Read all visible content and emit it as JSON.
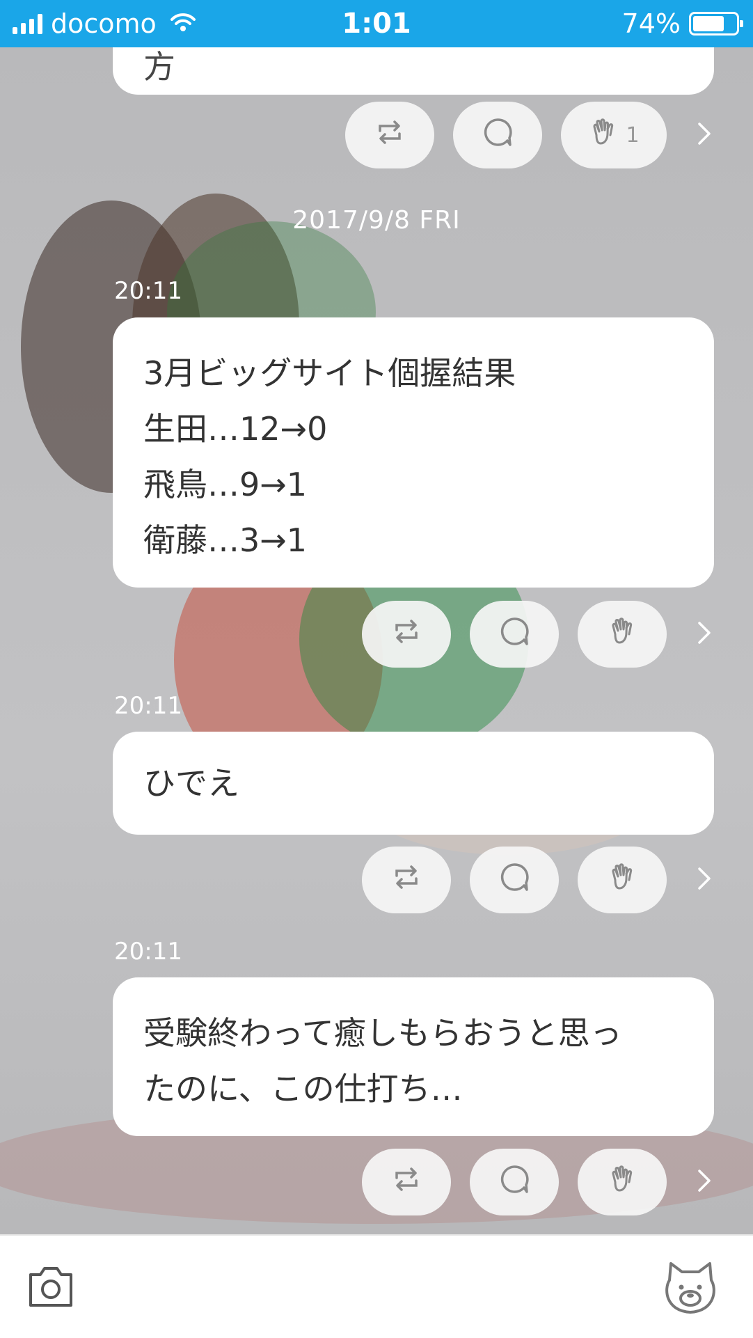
{
  "status_bar": {
    "carrier": "docomo",
    "time": "1:01",
    "battery_percent": "74%",
    "battery_level": 0.74
  },
  "feed": {
    "top_post": {
      "partial_text": "方",
      "applause_count": "1"
    },
    "date_header": "2017/9/8 FRI",
    "posts": [
      {
        "time": "20:11",
        "lines": [
          "3月ビッグサイト個握結果",
          "生田…12→0",
          "飛鳥…9→1",
          "衛藤…3→1"
        ]
      },
      {
        "time": "20:11",
        "lines": [
          "ひでえ"
        ]
      },
      {
        "time": "20:11",
        "lines": [
          "受験終わって癒しもらおうと思っ",
          "たのに、この仕打ち…"
        ]
      }
    ]
  },
  "icons": {
    "repost": "repost-icon",
    "comment": "comment-icon",
    "applause": "applause-icon",
    "more": "chevron-right-icon",
    "camera": "camera-icon",
    "mascot": "bear-icon"
  },
  "colors": {
    "status_bar": "#1aa6e8",
    "bubble": "#ffffff",
    "text": "#333333"
  }
}
